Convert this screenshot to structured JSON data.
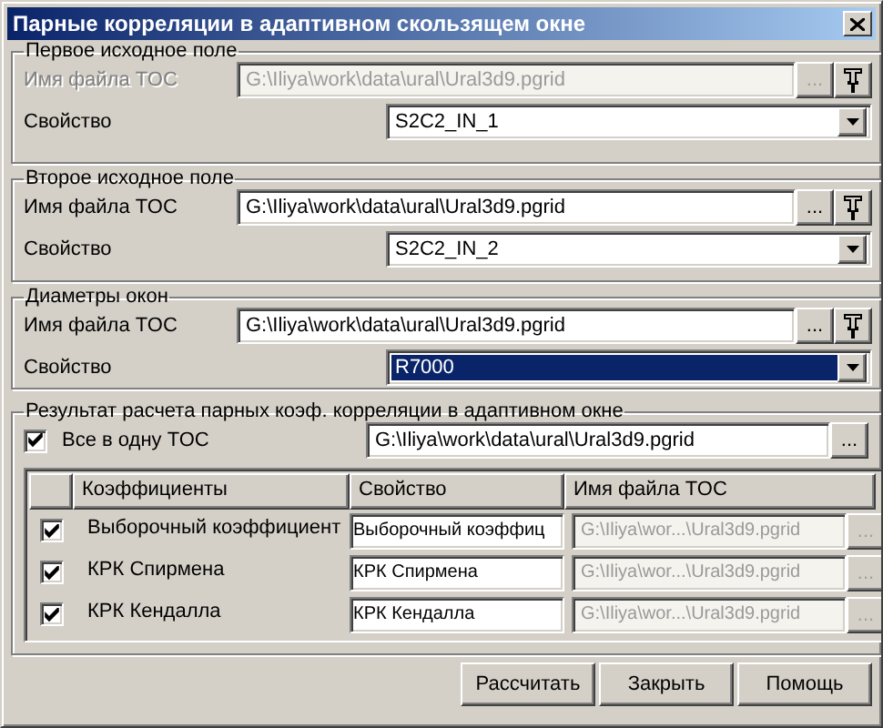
{
  "window": {
    "title": "Парные корреляции в адаптивном скользящем окне"
  },
  "groups": [
    {
      "title": "Первое исходное поле",
      "file": {
        "label": "Имя файла TOC",
        "value": "G:\\Iliya\\work\\data\\ural\\Ural3d9.pgrid",
        "disabled": true,
        "browse": "..."
      },
      "property": {
        "label": "Свойство",
        "value": "S2C2_IN_1",
        "focused": false
      }
    },
    {
      "title": "Второе исходное поле",
      "file": {
        "label": "Имя файла TOC",
        "value": "G:\\Iliya\\work\\data\\ural\\Ural3d9.pgrid",
        "disabled": false,
        "browse": "..."
      },
      "property": {
        "label": "Свойство",
        "value": "S2C2_IN_2",
        "focused": false
      }
    },
    {
      "title": "Диаметры окон",
      "file": {
        "label": "Имя файла TOC",
        "value": "G:\\Iliya\\work\\data\\ural\\Ural3d9.pgrid",
        "disabled": false,
        "browse": "..."
      },
      "property": {
        "label": "Свойство",
        "value": "R7000",
        "focused": true
      }
    }
  ],
  "result": {
    "title": "Результат расчета парных коэф. корреляции в адаптивном окне",
    "all_in_one": {
      "label": "Все в одну TOC",
      "checked": true
    },
    "path": "G:\\Iliya\\work\\data\\ural\\Ural3d9.pgrid",
    "browse": "...",
    "table": {
      "columns": [
        "Коэффициенты",
        "Свойство",
        "Имя файла TOC"
      ],
      "rows": [
        {
          "checked": true,
          "name": "Выборочный коэффициент",
          "property": "Выборочный коэффиц",
          "file": "G:\\Iliya\\wor...\\Ural3d9.pgrid",
          "file_disabled": true,
          "browse": "..."
        },
        {
          "checked": true,
          "name": "КРК Спирмена",
          "property": "КРК Спирмена",
          "file": "G:\\Iliya\\wor...\\Ural3d9.pgrid",
          "file_disabled": true,
          "browse": "..."
        },
        {
          "checked": true,
          "name": "КРК Кендалла",
          "property": "КРК Кендалла",
          "file": "G:\\Iliya\\wor...\\Ural3d9.pgrid",
          "file_disabled": true,
          "browse": "..."
        }
      ]
    }
  },
  "buttons": [
    "Рассчитать",
    "Закрыть",
    "Помощь"
  ]
}
